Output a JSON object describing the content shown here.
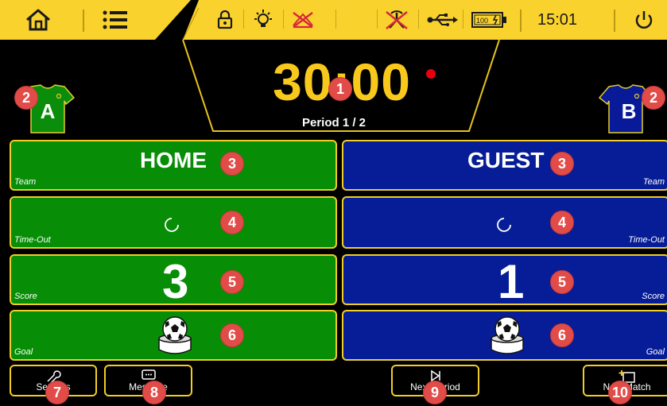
{
  "topbar": {
    "clock": "15:01",
    "icons": [
      "home-icon",
      "menu-icon",
      "lock-icon",
      "light-icon",
      "horn-muted-icon",
      "signal-off-icon",
      "usb-icon",
      "battery-icon",
      "power-icon"
    ],
    "battery_text": "100"
  },
  "timer": {
    "time": "30:00",
    "period": "Period 1 / 2",
    "running_dot_color": "#e8000e"
  },
  "home": {
    "jersey_letter": "A",
    "jersey_color": "#0a8d0a",
    "team_name": "HOME",
    "team_label": "Team",
    "timeout_label": "Time-Out",
    "score": "3",
    "score_label": "Score",
    "goal_label": "Goal",
    "panel_color": "#078d06"
  },
  "guest": {
    "jersey_letter": "B",
    "jersey_color": "#081a98",
    "team_name": "GUEST",
    "team_label": "Team",
    "timeout_label": "Time-Out",
    "score": "1",
    "score_label": "Score",
    "goal_label": "Goal",
    "panel_color": "#071d97"
  },
  "badges": {
    "b1": "1",
    "b2": "2",
    "b3": "3",
    "b4": "4",
    "b5": "5",
    "b6": "6",
    "b7": "7",
    "b8": "8",
    "b9": "9",
    "b10": "10"
  },
  "buttons": {
    "settings": "Settings",
    "message": "Message",
    "next_period": "Next Period",
    "new_match": "New Match"
  },
  "colors": {
    "accent": "#fad22d",
    "border": "#f1cd27",
    "timer": "#f8c91c",
    "badge": "#e14b48"
  }
}
